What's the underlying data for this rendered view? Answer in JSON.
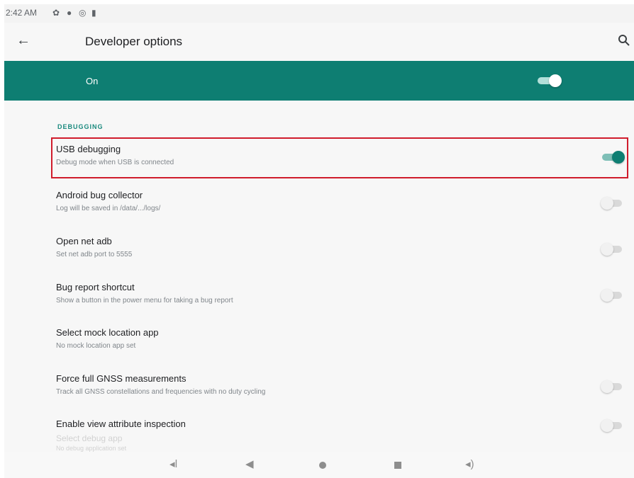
{
  "status_bar": {
    "time": "2:42 AM"
  },
  "app_bar": {
    "title": "Developer options"
  },
  "master_switch": {
    "label": "On",
    "state": "on"
  },
  "section": {
    "header": "DEBUGGING"
  },
  "settings": [
    {
      "title": "USB debugging",
      "subtitle": "Debug mode when USB is connected",
      "toggle": "on"
    },
    {
      "title": "Android bug collector",
      "subtitle": "Log will be saved in /data/.../logs/",
      "toggle": "off"
    },
    {
      "title": "Open net adb",
      "subtitle": "Set net adb port to 5555",
      "toggle": "off"
    },
    {
      "title": "Bug report shortcut",
      "subtitle": "Show a button in the power menu for taking a bug report",
      "toggle": "off"
    },
    {
      "title": "Select mock location app",
      "subtitle": "No mock location app set"
    },
    {
      "title": "Force full GNSS measurements",
      "subtitle": "Track all GNSS constellations and frequencies with no duty cycling",
      "toggle": "off"
    },
    {
      "title": "Enable view attribute inspection",
      "toggle": "off"
    }
  ],
  "partial_row": {
    "title": "Select debug app",
    "subtitle": "No debug application set"
  },
  "colors": {
    "accent": "#0e7e72",
    "highlight_border": "#d01c2c"
  },
  "icons": {
    "back": "arrow-left-icon",
    "search": "search-icon",
    "nav": [
      "volume-down-icon",
      "back-triangle-icon",
      "home-circle-icon",
      "recents-square-icon",
      "volume-up-icon"
    ]
  }
}
